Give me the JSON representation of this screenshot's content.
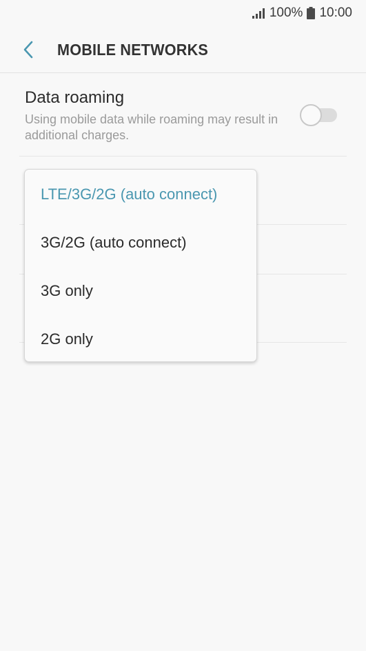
{
  "status_bar": {
    "battery": "100%",
    "time": "10:00"
  },
  "header": {
    "title": "MOBILE NETWORKS"
  },
  "settings": {
    "data_roaming": {
      "title": "Data roaming",
      "summary": "Using mobile data while roaming may result in additional charges.",
      "enabled": false
    }
  },
  "network_mode_menu": {
    "selected_index": 0,
    "options": [
      {
        "label": "LTE/3G/2G (auto connect)"
      },
      {
        "label": "3G/2G (auto connect)"
      },
      {
        "label": "3G only"
      },
      {
        "label": "2G only"
      }
    ]
  },
  "colors": {
    "accent": "#4a97b0",
    "background": "#f8f8f8"
  }
}
